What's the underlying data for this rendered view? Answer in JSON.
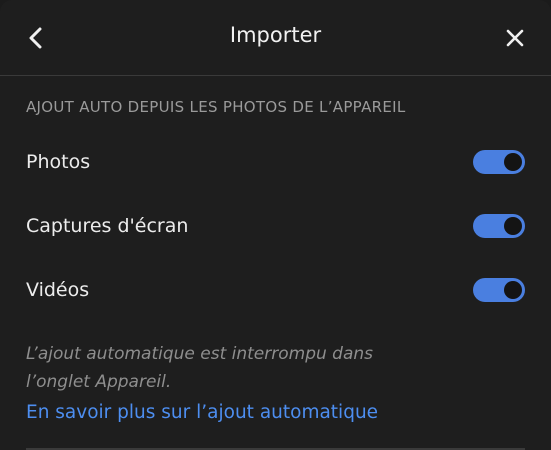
{
  "header": {
    "title": "Importer",
    "back_icon": "chevron-left-icon",
    "close_icon": "close-icon"
  },
  "section": {
    "label": "AJOUT AUTO DEPUIS LES PHOTOS DE L’APPAREIL"
  },
  "toggles": [
    {
      "label": "Photos",
      "on": true
    },
    {
      "label": "Captures d'écran",
      "on": true
    },
    {
      "label": "Vidéos",
      "on": true
    }
  ],
  "note": "L’ajout automatique est interrompu dans l’onglet Appareil.",
  "link": {
    "label": "En savoir plus sur l’ajout automatique"
  },
  "colors": {
    "background": "#1e1e1e",
    "toggle_on": "#4a7fe0",
    "link": "#4d8ef0",
    "muted_text": "#8e8e8e"
  }
}
